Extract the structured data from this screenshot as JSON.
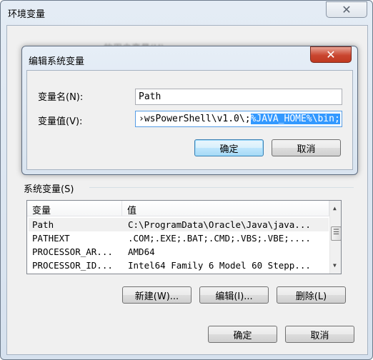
{
  "outer": {
    "title": "环境变量",
    "close_icon": "close-icon",
    "background_hint": "的用户变量(U)"
  },
  "edit_dialog": {
    "title": "编辑系统变量",
    "name_label": "变量名(N):",
    "name_value": "Path",
    "value_label": "变量值(V):",
    "value_unselected": "›wsPowerShell\\v1.0\\;",
    "value_selected": "%JAVA_HOME%\\bin;",
    "ok": "确定",
    "cancel": "取消",
    "close_color": "#c9452f"
  },
  "system_vars": {
    "group_label": "系统变量(S)",
    "columns": [
      "变量",
      "值"
    ],
    "rows": [
      {
        "name": "Path",
        "value": "C:\\ProgramData\\Oracle\\Java\\java..."
      },
      {
        "name": "PATHEXT",
        "value": ".COM;.EXE;.BAT;.CMD;.VBS;.VBE;...."
      },
      {
        "name": "PROCESSOR_AR...",
        "value": "AMD64"
      },
      {
        "name": "PROCESSOR_ID...",
        "value": "Intel64 Family 6 Model 60 Stepp..."
      }
    ],
    "new": "新建(W)...",
    "edit": "编辑(I)...",
    "delete": "删除(L)"
  },
  "footer": {
    "ok": "确定",
    "cancel": "取消"
  }
}
